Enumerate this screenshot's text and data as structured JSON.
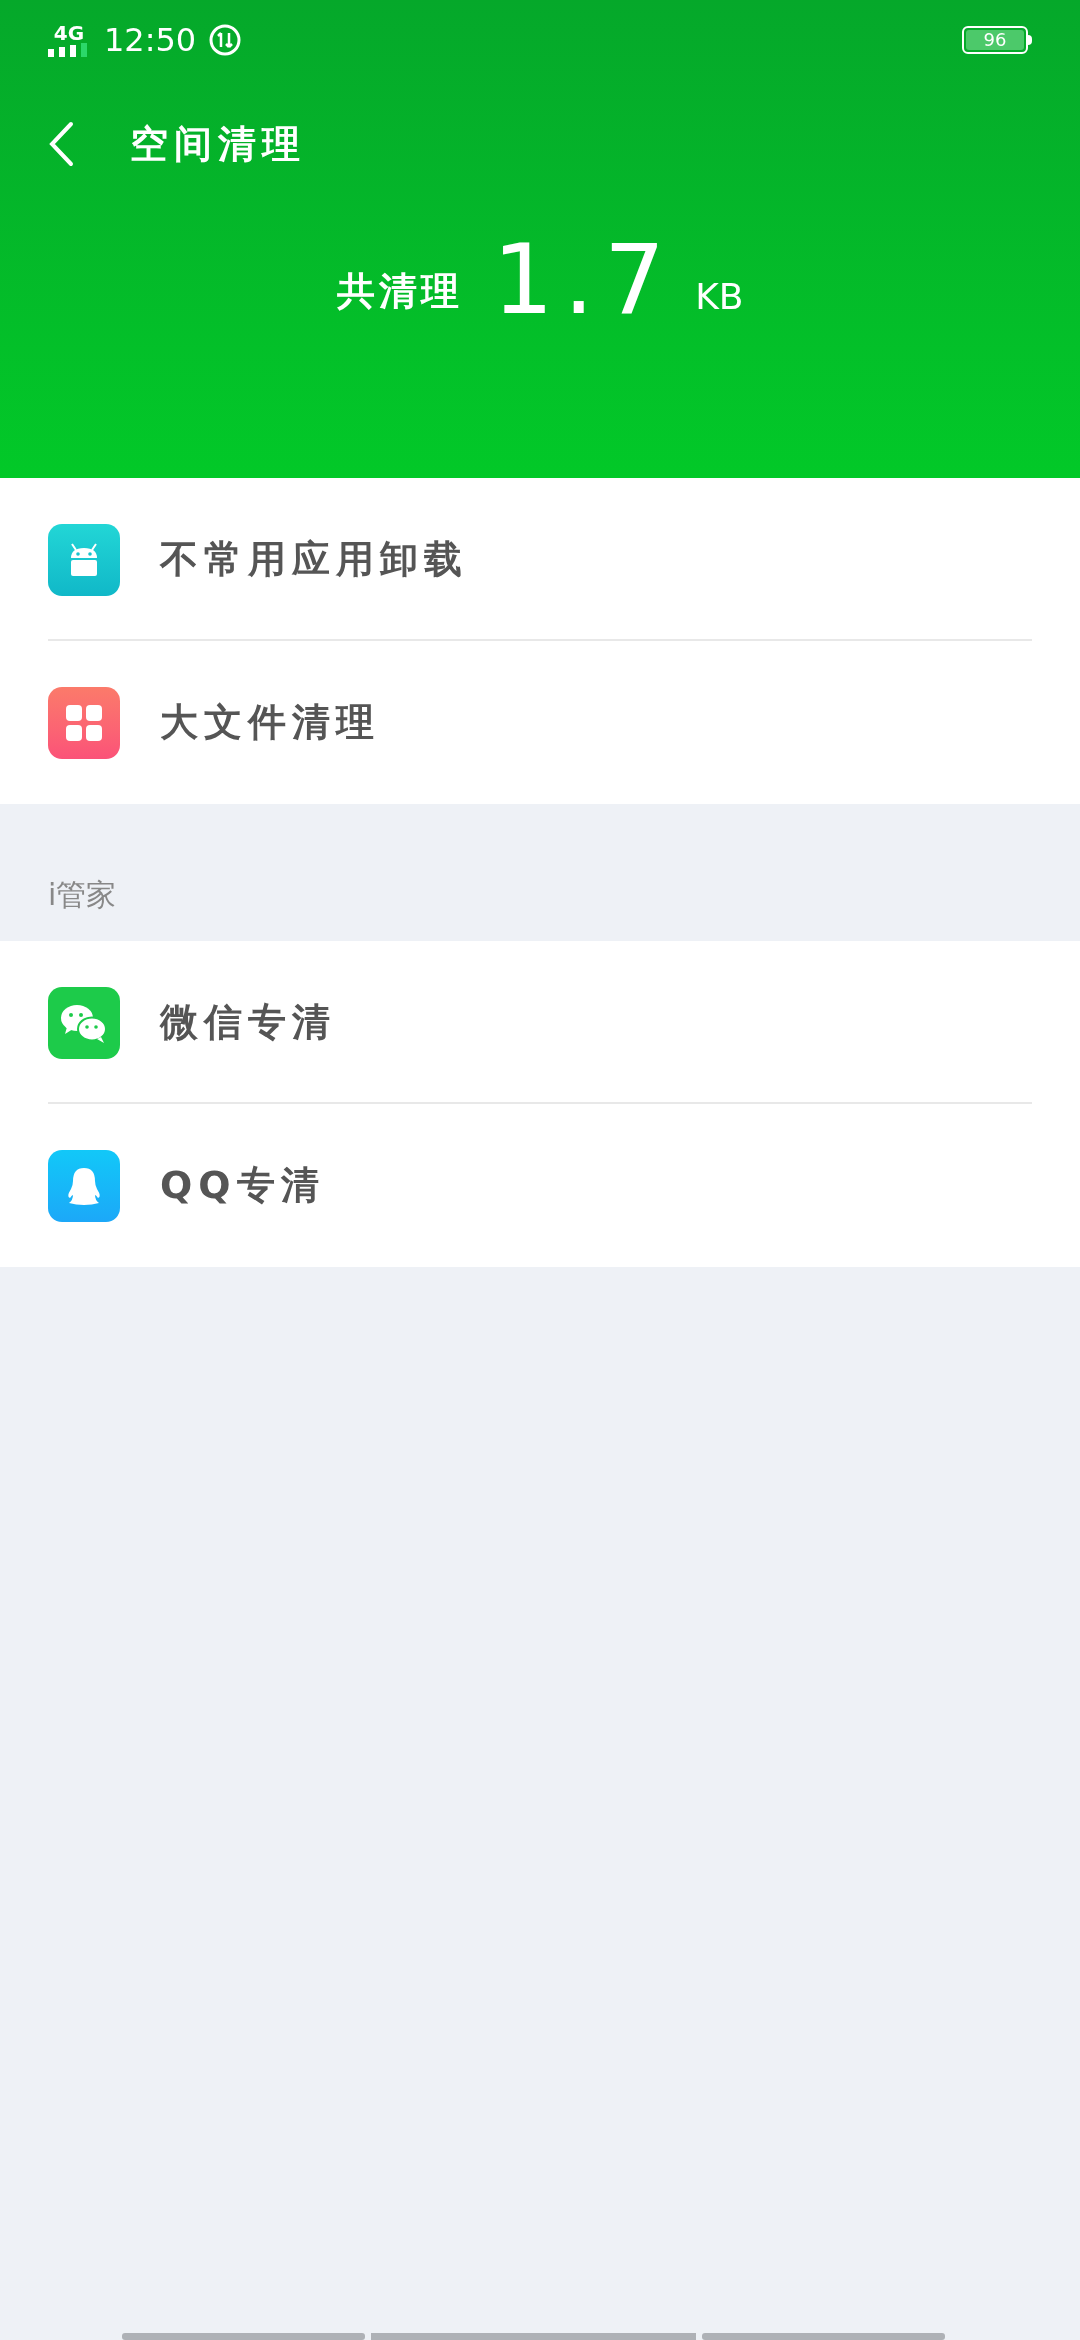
{
  "status_bar": {
    "network": "4G",
    "time": "12:50",
    "battery": "96"
  },
  "header": {
    "title": "空间清理",
    "summary_label": "共清理",
    "amount": "1.7",
    "unit": "KB"
  },
  "sections": [
    {
      "items": [
        {
          "kind": "android",
          "label": "不常用应用卸载"
        },
        {
          "kind": "grid",
          "label": "大文件清理"
        }
      ]
    },
    {
      "title": "i管家",
      "items": [
        {
          "kind": "chat",
          "label": "微信专清"
        },
        {
          "kind": "penguin",
          "label": "QQ专清"
        }
      ]
    }
  ]
}
